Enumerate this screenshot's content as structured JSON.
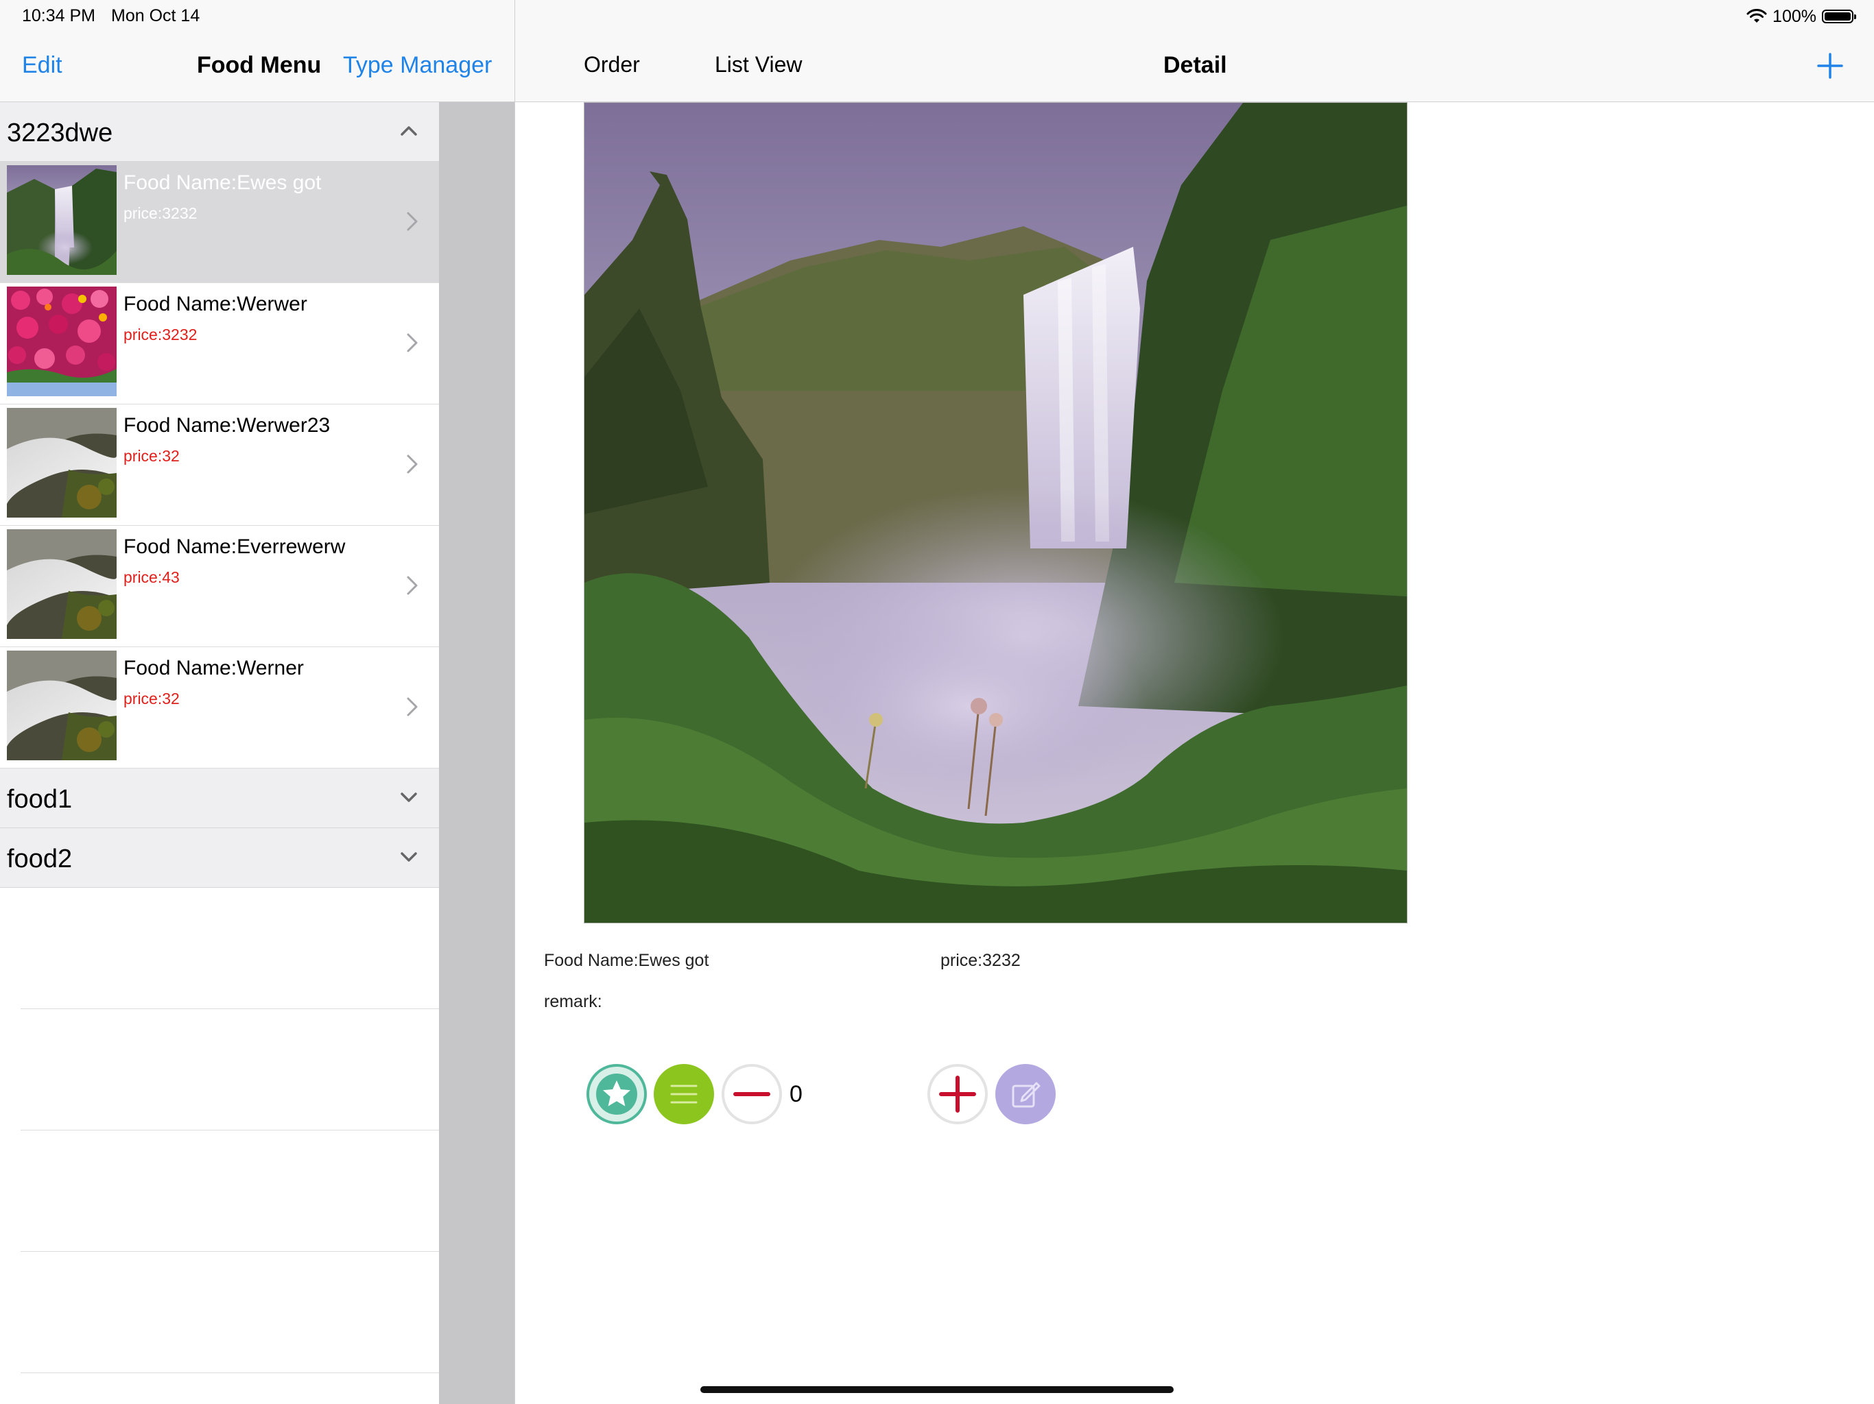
{
  "status_bar": {
    "time": "10:34 PM",
    "date": "Mon Oct 14",
    "battery": "100%"
  },
  "master": {
    "edit_label": "Edit",
    "title": "Food Menu",
    "type_manager_label": "Type Manager",
    "sections": [
      {
        "title": "3223dwe",
        "expanded": true,
        "items": [
          {
            "name": "Food Name:Ewes got",
            "price": "price:3232",
            "image": "waterfall",
            "selected": true
          },
          {
            "name": "Food Name:Werwer",
            "price": "price:3232",
            "image": "flowers",
            "selected": false
          },
          {
            "name": "Food Name:Werwer23",
            "price": "price:32",
            "image": "stream",
            "selected": false
          },
          {
            "name": "Food Name:Everrewerw",
            "price": "price:43",
            "image": "stream",
            "selected": false
          },
          {
            "name": "Food Name:Werner",
            "price": "price:32",
            "image": "stream",
            "selected": false
          }
        ]
      },
      {
        "title": "food1",
        "expanded": false,
        "items": []
      },
      {
        "title": "food2",
        "expanded": false,
        "items": []
      }
    ]
  },
  "detail": {
    "order_label": "Order",
    "list_view_label": "List View",
    "title": "Detail",
    "add_icon": "plus-icon",
    "food_name": "Food Name:Ewes got",
    "price": "price:3232",
    "remark": "remark:",
    "quantity": "0",
    "buttons": [
      {
        "icon": "star-icon",
        "color": "#4fb89a"
      },
      {
        "icon": "list-icon",
        "color": "#8dc51f"
      },
      {
        "icon": "minus-icon",
        "color": "#c8102e"
      },
      {
        "icon": "plus-icon",
        "color": "#c8102e"
      },
      {
        "icon": "edit-icon",
        "color": "#b3a8e0"
      }
    ]
  },
  "colors": {
    "accent": "#1f83e8",
    "price": "#e0201b"
  }
}
